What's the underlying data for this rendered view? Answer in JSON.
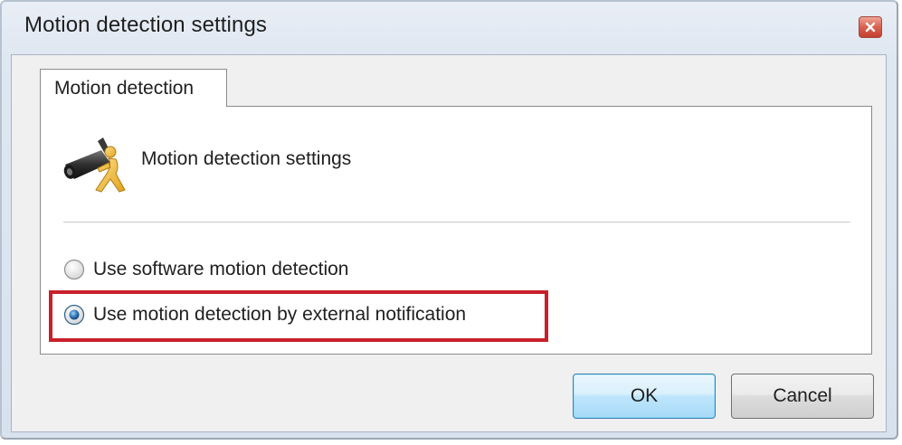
{
  "window": {
    "title": "Motion detection settings"
  },
  "tabs": [
    {
      "label": "Motion detection",
      "selected": true
    }
  ],
  "section": {
    "icon": "camera-motion-icon",
    "title": "Motion detection settings"
  },
  "options": [
    {
      "label": "Use software motion detection",
      "selected": false
    },
    {
      "label": "Use motion detection by external notification",
      "selected": true
    }
  ],
  "buttons": {
    "ok": "OK",
    "cancel": "Cancel"
  },
  "colors": {
    "highlight": "#c8202a",
    "close_button": "#d9614f",
    "ok_border": "#3c7fb1"
  }
}
